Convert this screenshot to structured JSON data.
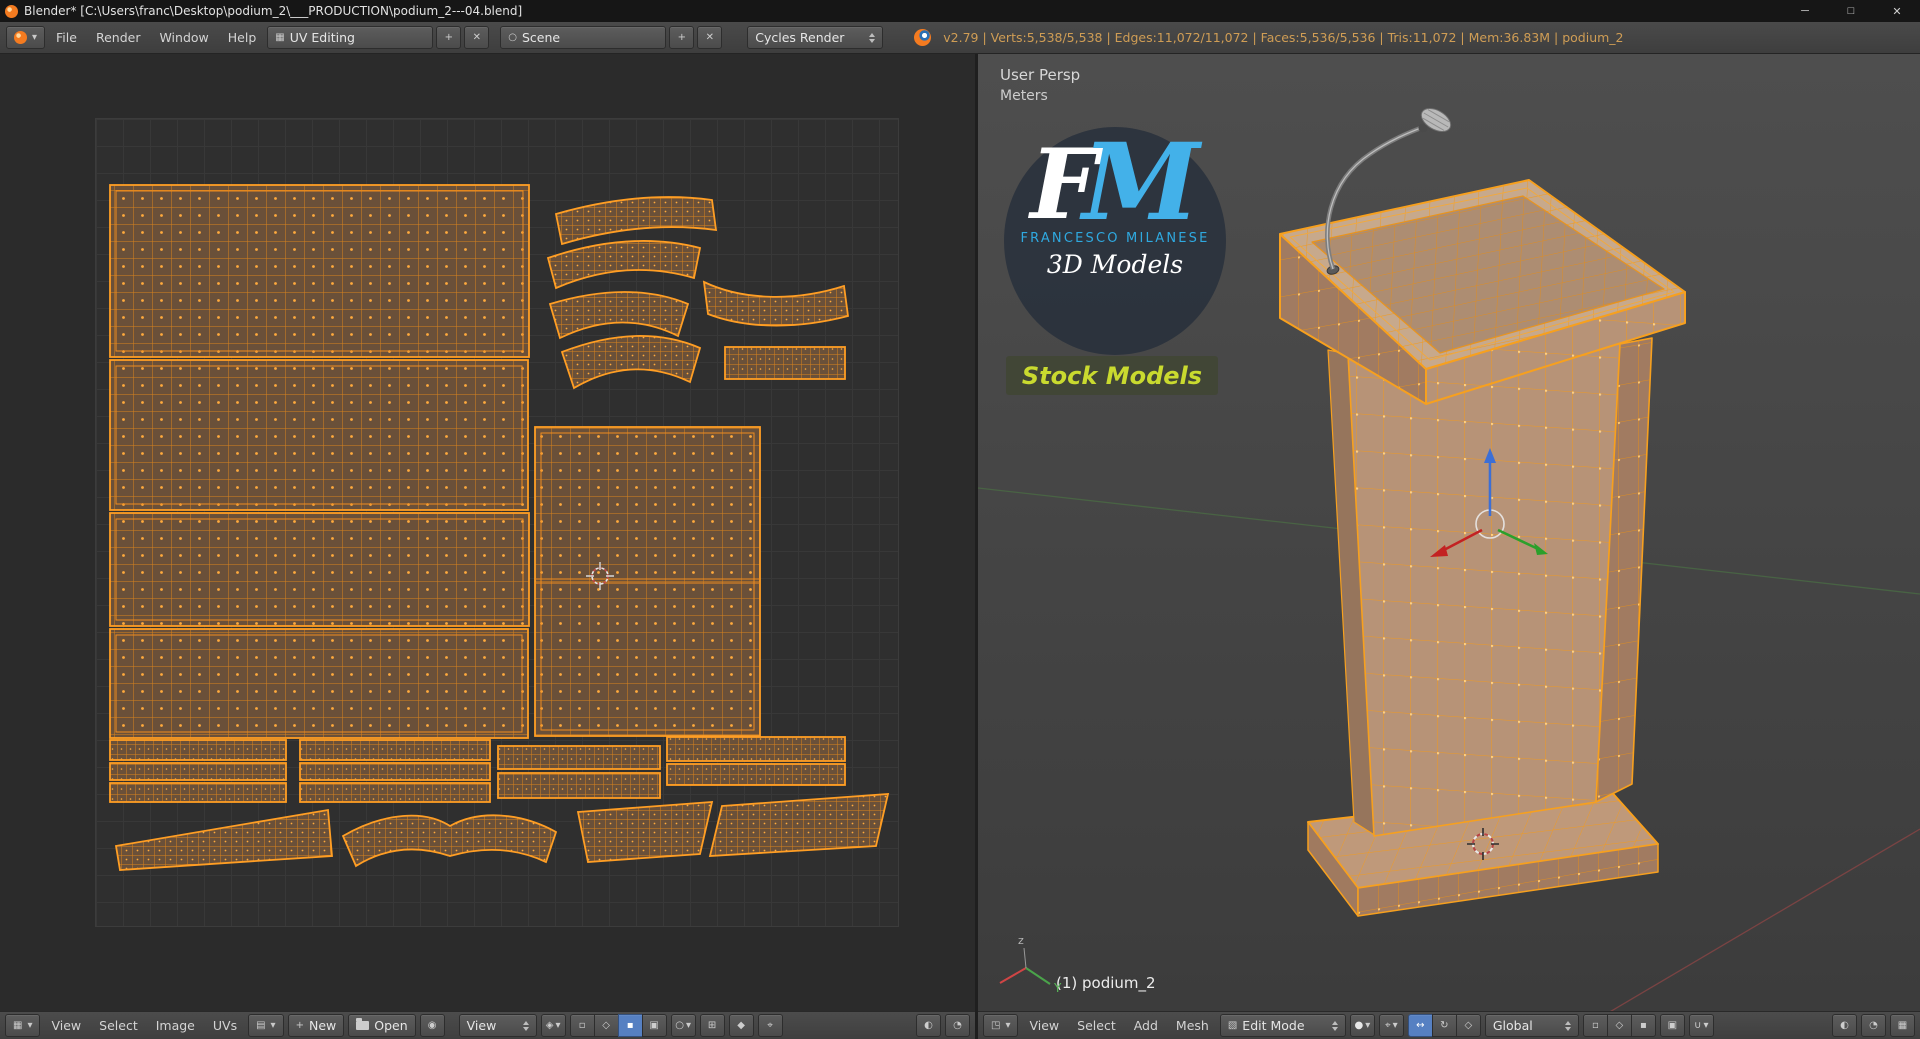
{
  "title_bar": {
    "title": "Blender* [C:\\Users\\franc\\Desktop\\podium_2\\___PRODUCTION\\podium_2---04.blend]",
    "minimize": "─",
    "maximize": "□",
    "close": "✕"
  },
  "info_header": {
    "menus": [
      "File",
      "Render",
      "Window",
      "Help"
    ],
    "layout": "UV Editing",
    "scene": "Scene",
    "engine": "Cycles Render",
    "stats": "v2.79 | Verts:5,538/5,538 | Edges:11,072/11,072 | Faces:5,536/5,536 | Tris:11,072 | Mem:36.83M | podium_2"
  },
  "uv_editor": {
    "menus": [
      "View",
      "Select",
      "Image",
      "UVs"
    ],
    "new_button": "New",
    "open_button": "Open",
    "mode_select": "View"
  },
  "viewport": {
    "persp_label": "User Persp",
    "units_label": "Meters",
    "object_label": "(1) podium_2",
    "menus": [
      "View",
      "Select",
      "Add",
      "Mesh"
    ],
    "mode_select": "Edit Mode",
    "orientation_select": "Global",
    "axis_y_label": "Y",
    "axis_z_label": "z",
    "logo": {
      "f": "F",
      "m": "M",
      "subtitle": "FRANCESCO MILANESE",
      "tagline": "3D Models",
      "badge": "Stock Models"
    }
  },
  "icons": {
    "dropdown": "▾",
    "plus": "+",
    "editor_uv": "▦",
    "editor_3d": "◳",
    "editor_info": "▤",
    "image_browser": "▤",
    "scene_dot": "○",
    "pin": "◉",
    "sticky": "◈",
    "select_vertex": "▫",
    "select_edge": "◇",
    "select_face": "▪",
    "select_island": "▣",
    "prop_edit": "○",
    "snap_uv": "⊞",
    "normals": "◆",
    "pivot": "⌖",
    "shading_sphere": "●",
    "mode_edit": "▧",
    "manip_translate": "↔",
    "manip_rotate": "↻",
    "manip_scale": "◇",
    "magnet": "∪",
    "render_a": "◐",
    "render_b": "◔"
  }
}
